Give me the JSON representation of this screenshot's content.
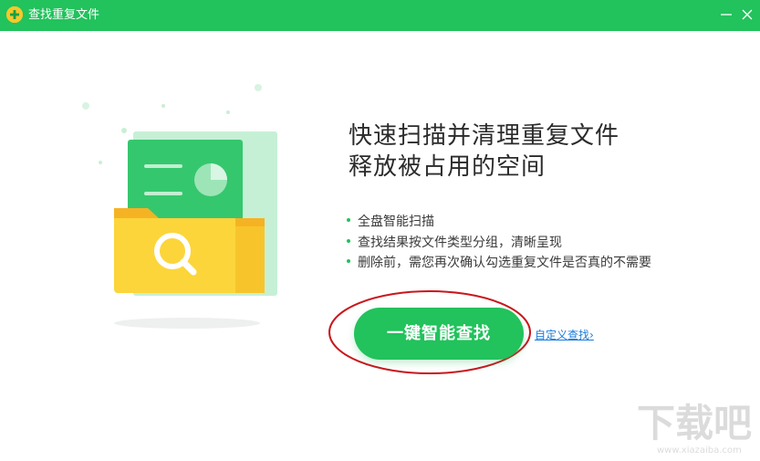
{
  "window": {
    "title": "查找重复文件",
    "accent": "#22c25c"
  },
  "headline": {
    "line1": "快速扫描并清理重复文件",
    "line2": "释放被占用的空间"
  },
  "features": [
    "全盘智能扫描",
    "查找结果按文件类型分组，清晰呈现",
    "删除前，需您再次确认勾选重复文件是否真的不需要"
  ],
  "actions": {
    "scan_label": "一键智能查找",
    "custom_label": "自定义查找",
    "custom_arrow": "›"
  },
  "watermark": {
    "main": "下载吧",
    "sub": "www.xiazaiba.com"
  },
  "icons": {
    "app": "app-logo-icon",
    "minimize": "minimize-icon",
    "close": "close-icon",
    "illustration": "folder-search-illustration"
  }
}
